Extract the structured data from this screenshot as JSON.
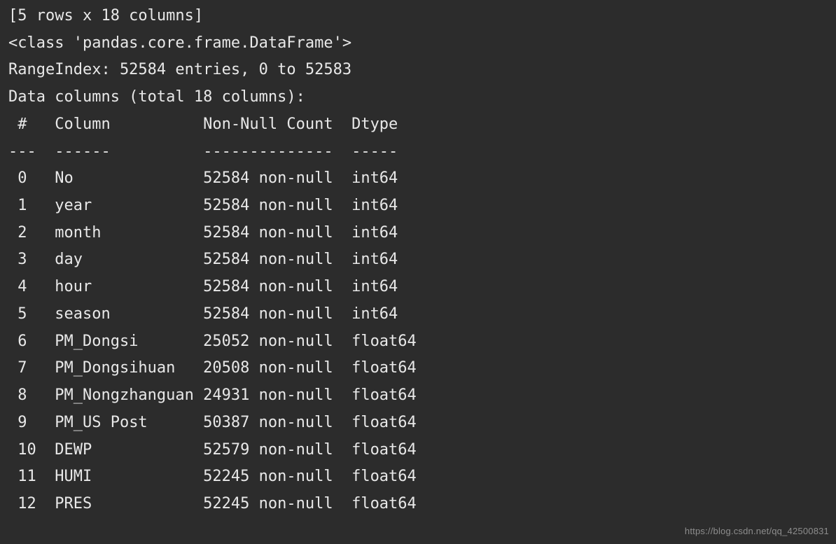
{
  "intro": {
    "shape_line": "[5 rows x 18 columns]",
    "class_line": "<class 'pandas.core.frame.DataFrame'>",
    "rangeindex_line": "RangeIndex: 52584 entries, 0 to 52583",
    "datacols_line": "Data columns (total 18 columns):"
  },
  "header": {
    "idx": " #  ",
    "col": " Column         ",
    "nn": " Non-Null Count ",
    "dt": " Dtype  "
  },
  "divider": {
    "idx": "--- ",
    "col": " ------         ",
    "nn": " -------------- ",
    "dt": " -----  "
  },
  "rows": [
    {
      "idx": " 0  ",
      "col": " No             ",
      "nn": " 52584 non-null ",
      "dt": " int64  "
    },
    {
      "idx": " 1  ",
      "col": " year           ",
      "nn": " 52584 non-null ",
      "dt": " int64  "
    },
    {
      "idx": " 2  ",
      "col": " month          ",
      "nn": " 52584 non-null ",
      "dt": " int64  "
    },
    {
      "idx": " 3  ",
      "col": " day            ",
      "nn": " 52584 non-null ",
      "dt": " int64  "
    },
    {
      "idx": " 4  ",
      "col": " hour           ",
      "nn": " 52584 non-null ",
      "dt": " int64  "
    },
    {
      "idx": " 5  ",
      "col": " season         ",
      "nn": " 52584 non-null ",
      "dt": " int64  "
    },
    {
      "idx": " 6  ",
      "col": " PM_Dongsi      ",
      "nn": " 25052 non-null ",
      "dt": " float64"
    },
    {
      "idx": " 7  ",
      "col": " PM_Dongsihuan  ",
      "nn": " 20508 non-null ",
      "dt": " float64"
    },
    {
      "idx": " 8  ",
      "col": " PM_Nongzhanguan",
      "nn": " 24931 non-null ",
      "dt": " float64"
    },
    {
      "idx": " 9  ",
      "col": " PM_US Post     ",
      "nn": " 50387 non-null ",
      "dt": " float64"
    },
    {
      "idx": " 10 ",
      "col": " DEWP           ",
      "nn": " 52579 non-null ",
      "dt": " float64"
    },
    {
      "idx": " 11 ",
      "col": " HUMI           ",
      "nn": " 52245 non-null ",
      "dt": " float64"
    },
    {
      "idx": " 12 ",
      "col": " PRES           ",
      "nn": " 52245 non-null ",
      "dt": " float64"
    }
  ],
  "watermark": "https://blog.csdn.net/qq_42500831"
}
